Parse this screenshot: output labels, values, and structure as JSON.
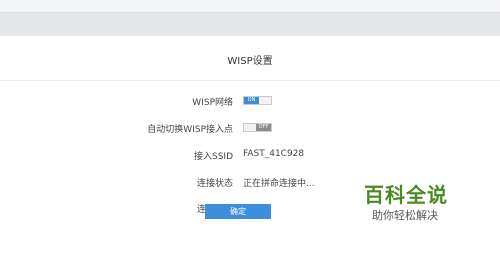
{
  "panel": {
    "title": "WISP设置"
  },
  "form": {
    "wisp_network": {
      "label": "WISP网络",
      "toggle_text": "ON",
      "state": "on"
    },
    "auto_switch": {
      "label": "自动切换WISP接入点",
      "toggle_text": "OFF",
      "state": "off"
    },
    "ssid": {
      "label": "接入SSID",
      "value": "FAST_41C928"
    },
    "conn_status": {
      "label": "连接状态",
      "value": "正在拼命连接中..."
    },
    "conn_time": {
      "label": "连接时间",
      "value": ""
    }
  },
  "buttons": {
    "confirm_label": "确定"
  },
  "colors": {
    "accent": "#3e8ede",
    "toggle_on": "#3b8dd8",
    "toggle_off": "#8c8c8c"
  },
  "watermark": {
    "main": "百科全说",
    "sub": "助你轻松解决"
  }
}
